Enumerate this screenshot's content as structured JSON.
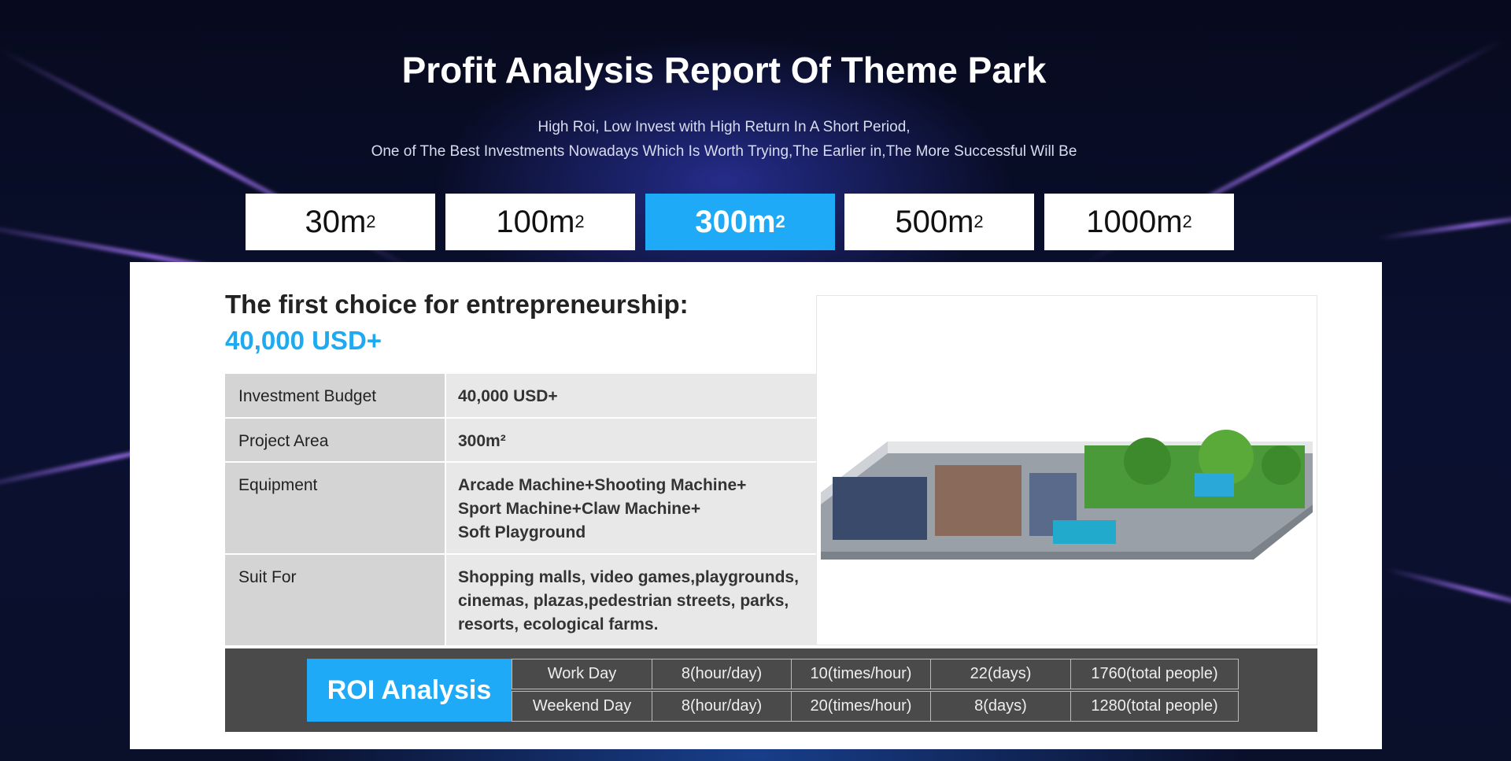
{
  "header": {
    "title": "Profit Analysis Report Of  Theme Park",
    "subtitle_line1": "High Roi, Low Invest with High Return In A Short Period,",
    "subtitle_line2": "One of The Best Investments Nowadays Which Is Worth Trying,The Earlier in,The More Successful Will Be"
  },
  "tabs": [
    {
      "label": "30m",
      "sup": "2"
    },
    {
      "label": "100m",
      "sup": "2"
    },
    {
      "label": "300m",
      "sup": "2",
      "active": true
    },
    {
      "label": "500m",
      "sup": "2"
    },
    {
      "label": "1000m",
      "sup": "2"
    }
  ],
  "main": {
    "heading": "The first choice for entrepreneurship:",
    "price": "40,000 USD+",
    "rows": [
      {
        "label": "Investment Budget",
        "value": [
          "40,000 USD+"
        ]
      },
      {
        "label": "Project Area",
        "value": [
          "300m²"
        ]
      },
      {
        "label": "Equipment",
        "value": [
          "Arcade Machine+Shooting Machine+",
          "Sport Machine+Claw Machine+",
          "Soft Playground"
        ]
      },
      {
        "label": "Suit For",
        "value": [
          "Shopping malls, video games,playgrounds,",
          "cinemas, plazas,pedestrian streets, parks,",
          "resorts, ecological farms."
        ]
      }
    ]
  },
  "roi": {
    "label": "ROI Analysis",
    "rows": [
      [
        "Work Day",
        "8(hour/day)",
        "10(times/hour)",
        "22(days)",
        "1760(total people)"
      ],
      [
        "Weekend Day",
        "8(hour/day)",
        "20(times/hour)",
        "8(days)",
        "1280(total people)"
      ]
    ]
  },
  "colors": {
    "accent": "#1eaaf7",
    "roi_bg": "#4a4a4a"
  }
}
